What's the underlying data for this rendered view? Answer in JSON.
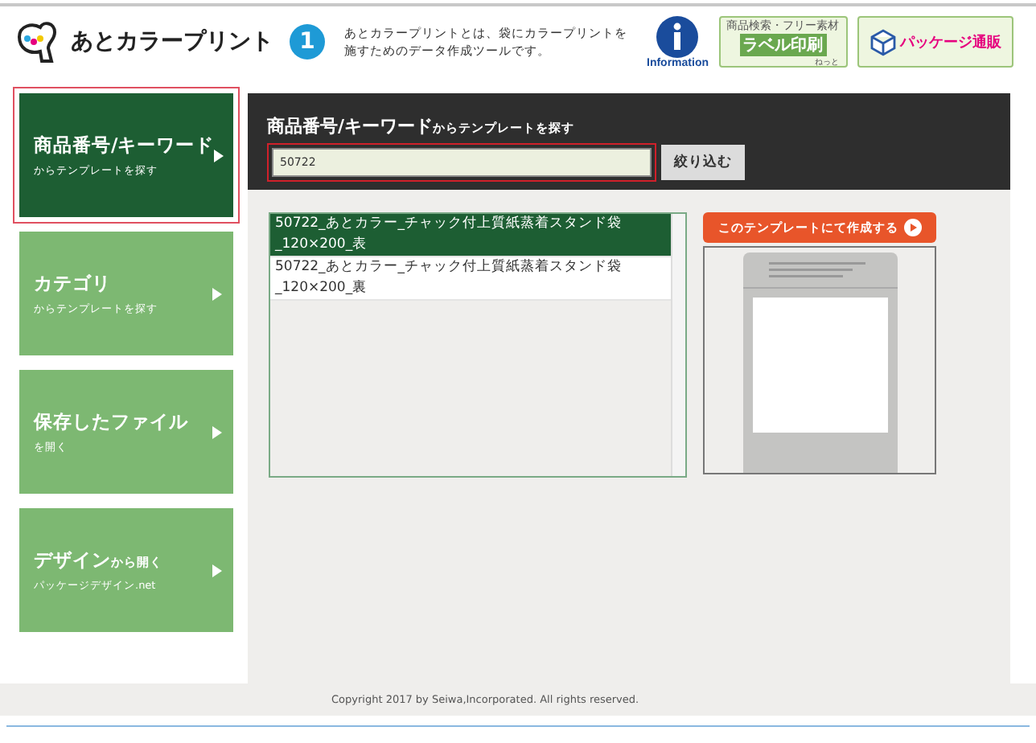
{
  "header": {
    "logo_text": "あとカラープリント",
    "step": "1",
    "description": "あとカラープリントとは、袋にカラープリントを施すためのデータ作成ツールです。",
    "info_label": "Information",
    "banners": [
      {
        "kind": "label",
        "caption": "商品検索・フリー素材",
        "title": "ラベル印刷",
        "sub": "ねっと"
      },
      {
        "kind": "package",
        "title": "パッケージ通販"
      }
    ]
  },
  "sidebar": {
    "items": [
      {
        "title": "商品番号/キーワード",
        "subtitle": "からテンプレートを探す",
        "selected": true
      },
      {
        "title": "カテゴリ",
        "subtitle": "からテンプレートを探す",
        "selected": false
      },
      {
        "title": "保存したファイル",
        "subtitle": "を開く",
        "selected": false
      },
      {
        "title": "デザイン",
        "title_suffix": "から開く",
        "subtitle": "パッケージデザイン.net",
        "selected": false
      }
    ]
  },
  "search": {
    "heading": "商品番号/キーワード",
    "heading_suffix": "からテンプレートを探す",
    "value": "50722",
    "highlighted": true,
    "button": "絞り込む"
  },
  "results": [
    {
      "text": "50722_あとカラー_チャック付上質紙蒸着スタンド袋_120×200_表",
      "selected": true
    },
    {
      "text": "50722_あとカラー_チャック付上質紙蒸着スタンド袋_120×200_裏",
      "selected": false
    }
  ],
  "create_button": "このテンプレートにて作成する",
  "footer": {
    "copyright": "Copyright 2017 by Seiwa,Incorporated. All rights reserved."
  }
}
